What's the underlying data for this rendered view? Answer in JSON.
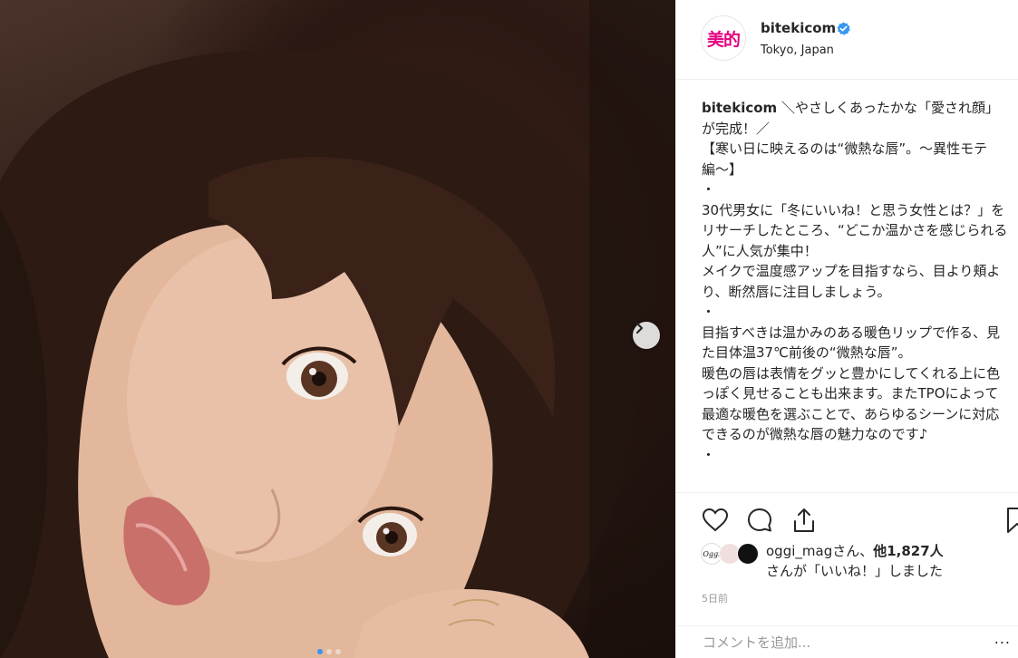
{
  "post": {
    "username": "bitekicom",
    "location": "Tokyo, Japan",
    "avatar_text": "美的",
    "avatar_color": "#e4007f",
    "caption_user": "bitekicom",
    "caption_lines": [
      " ＼やさしくあったかな「愛され顔」が完成！／",
      "【寒い日に映えるのは“微熱な唇”。〜異性モテ編〜】",
      "・",
      "30代男女に「冬にいいね！と思う女性とは？」をリサーチしたところ、“どこか温かさを感じられる人”に人気が集中！",
      "メイクで温度感アップを目指すなら、目より頬より、断然唇に注目しましょう。",
      "・",
      "目指すべきは温かみのある暖色リップで作る、見た目体温37℃前後の“微熱な唇”。",
      "暖色の唇は表情をグッと豊かにしてくれる上に色っぽく見せることも出来ます。またTPOによって最適な暖色を選ぶことで、あらゆるシーンに対応できるのが微熱な唇の魅力なのです♪",
      "・"
    ]
  },
  "likes": {
    "first_user": "oggi_mag",
    "san1": "さん、",
    "other_count": "他1,827人",
    "line2": "さんが「いいね！」しました",
    "avatar1_text": "Oggi"
  },
  "timestamp": "5日前",
  "comment": {
    "placeholder": "コメントを追加...",
    "more": "..."
  },
  "icons": {
    "next": "chevron-right-icon",
    "like": "heart-icon",
    "comment": "speech-bubble-icon",
    "share": "share-icon",
    "save": "bookmark-icon",
    "verified": "verified-badge-icon"
  },
  "carousel": {
    "count": 3,
    "active": 1
  },
  "colors": {
    "verified": "#3897f0",
    "text": "#262626",
    "muted": "#999999"
  }
}
